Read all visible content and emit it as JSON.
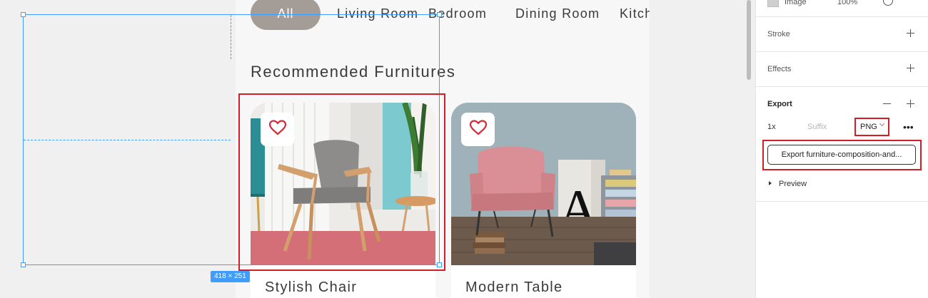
{
  "canvas": {
    "categories": [
      "All",
      "Living Room",
      "Bedroom",
      "Dining Room",
      "Kitchen"
    ],
    "section_title": "Recommended Furnitures",
    "cards": [
      {
        "name": "Stylish Chair",
        "favorite_icon": "heart-outline-icon"
      },
      {
        "name": "Modern Table",
        "favorite_icon": "heart-outline-icon"
      }
    ],
    "selection_size": "418 × 251",
    "accent_color": "#3f9dfd",
    "highlight_color": "#d21d2b",
    "pill_color": "#a39c97",
    "heart_color": "#d52b36"
  },
  "panel": {
    "image_layer": {
      "label": "Image",
      "opacity": "100%"
    },
    "stroke": {
      "label": "Stroke"
    },
    "effects": {
      "label": "Effects"
    },
    "export": {
      "label": "Export",
      "scale": "1x",
      "suffix_placeholder": "Suffix",
      "format": "PNG",
      "button_label": "Export furniture-composition-and...",
      "preview_label": "Preview"
    }
  }
}
